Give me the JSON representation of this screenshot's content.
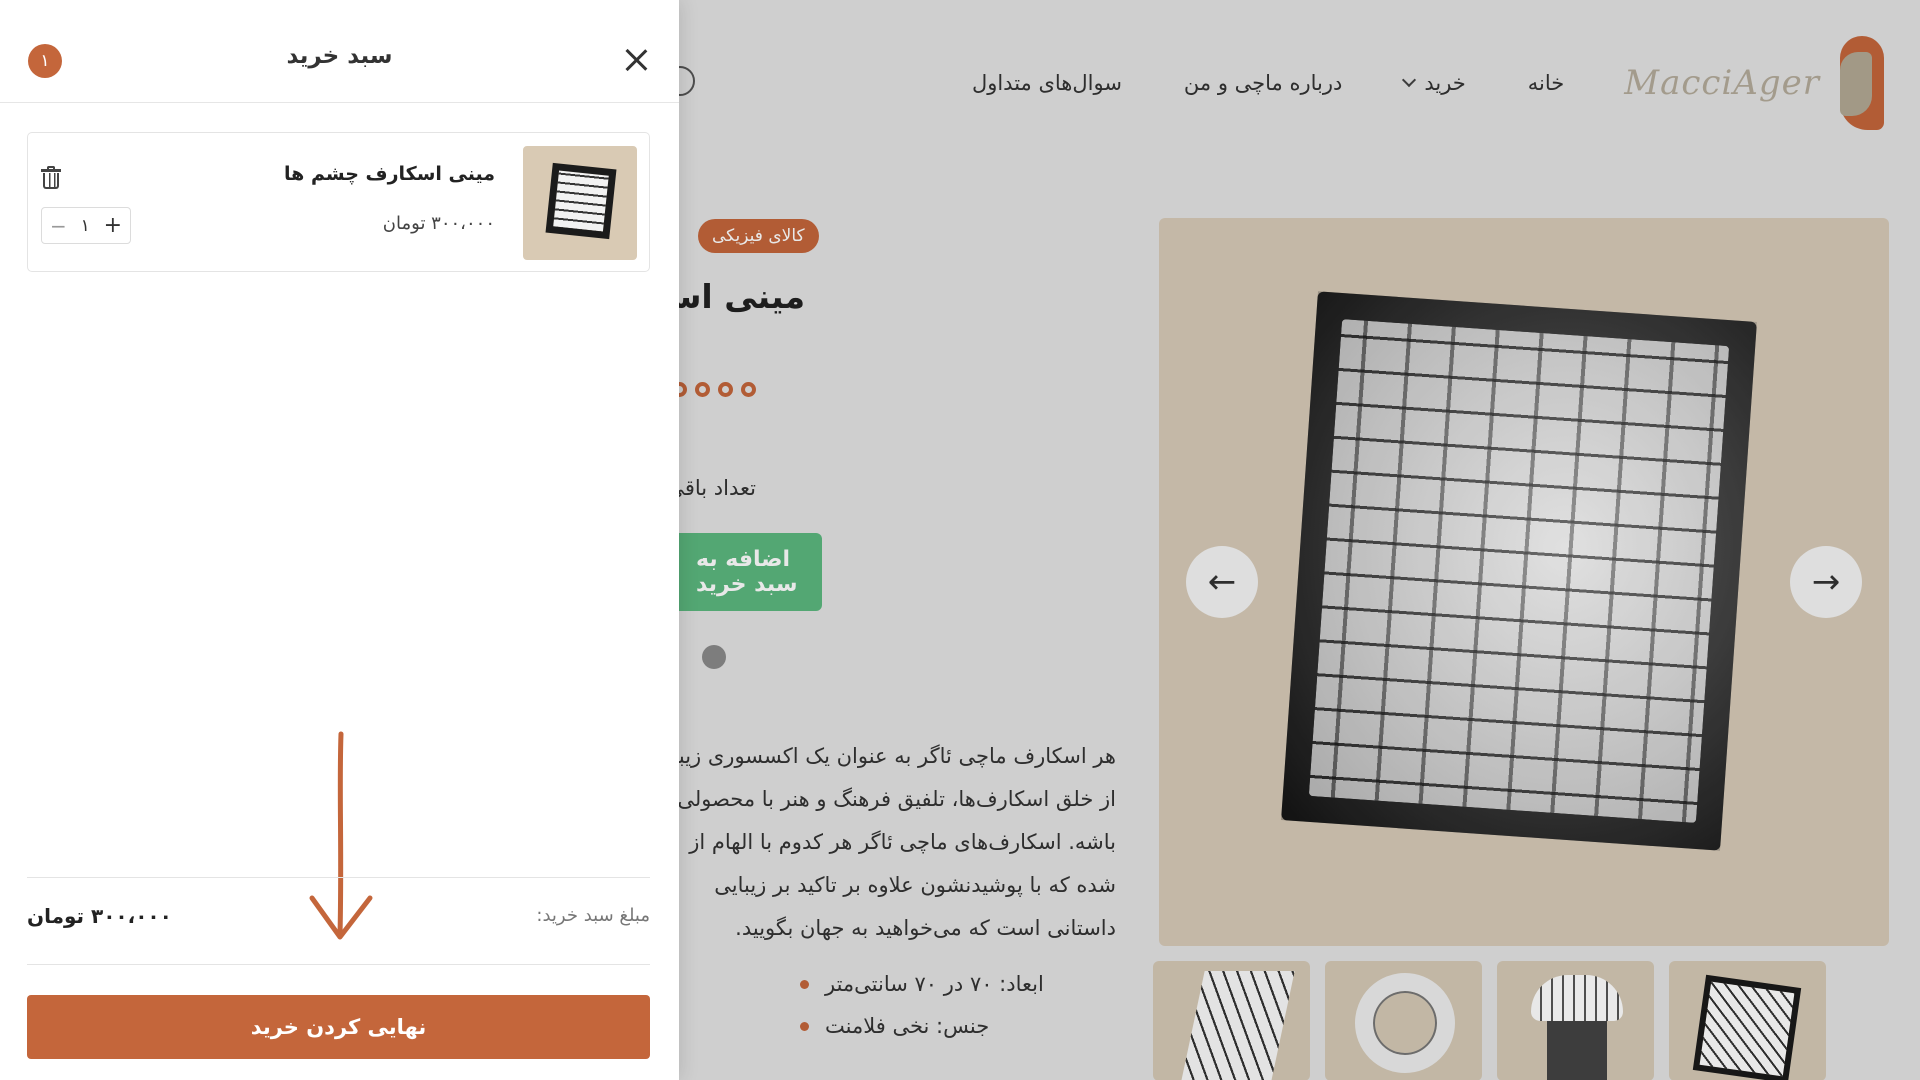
{
  "site": {
    "logo_text": "MacciAger",
    "nav": [
      {
        "label": "خانه"
      },
      {
        "label": "خرید"
      },
      {
        "label": "درباره ماچی و من"
      },
      {
        "label": "سوال‌های متداول"
      }
    ]
  },
  "product": {
    "badge": "کالای فیزیکی",
    "title": "مینی اسکارف چشم ها",
    "quantity_label": "تعداد باقی مانده",
    "add_button": "اضافه به سبد خرید",
    "description_lines": [
      "هر اسکارف ماچی ئاگر به عنوان یک اکسسوری زیبا",
      "از خلق اسکارف‌ها، تلفیق فرهنگ و هنر با محصولی",
      "باشه. اسکارف‌های ماچی ئاگر هر کدوم با الهام از",
      "شده که با پوشیدنشون علاوه بر تاکید بر زیبایی",
      "داستانی است که می‌خواهید به جهان بگویید."
    ],
    "specs": [
      "ابعاد: ۷۰ در ۷۰ سانتی‌متر",
      "جنس: نخی فلامنت"
    ],
    "gallery": {
      "prev_icon": "arrow-left-icon",
      "next_icon": "arrow-right-icon"
    }
  },
  "cart": {
    "title": "سبد خرید",
    "count": "۱",
    "items": [
      {
        "name": "مینی اسکارف چشم ها",
        "price": "۳۰۰،۰۰۰ تومان",
        "qty": "۱",
        "minus": "−",
        "plus": "+"
      }
    ],
    "total_label": "مبلغ سبد خرید:",
    "total_value": "۳۰۰،۰۰۰ تومان",
    "checkout": "نهایی کردن خرید"
  },
  "colors": {
    "accent": "#c4663b",
    "green": "#5cb87f"
  }
}
